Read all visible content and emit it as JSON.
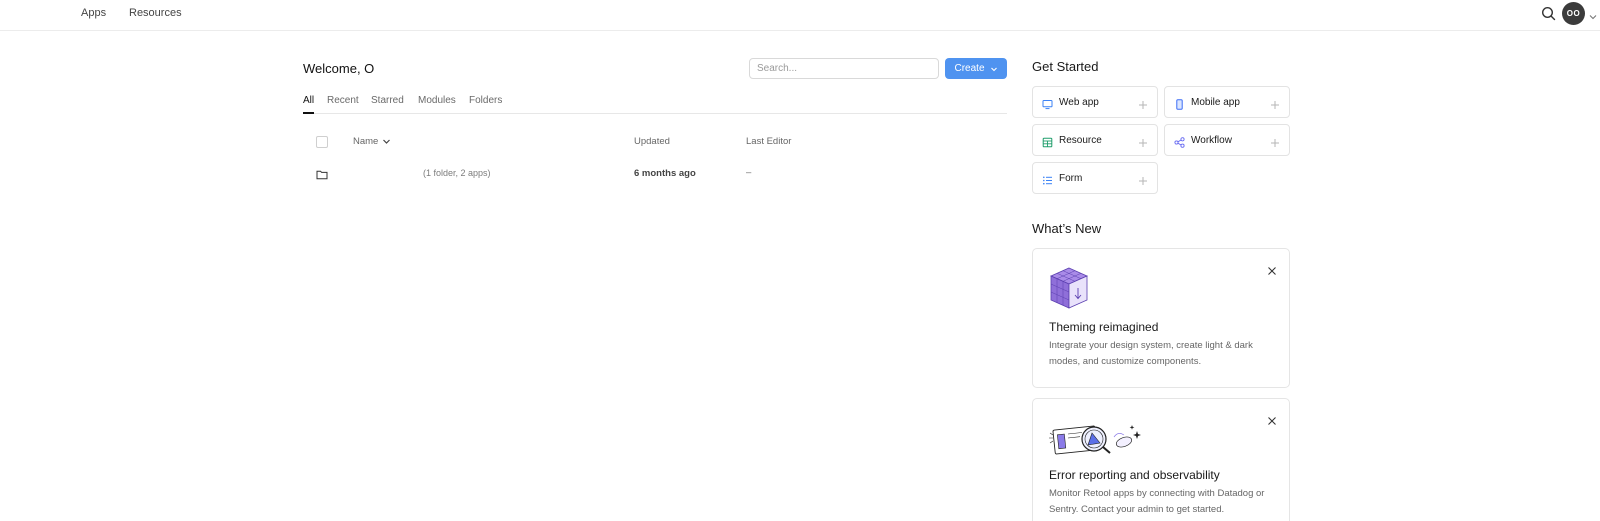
{
  "topnav": {
    "links": [
      "Apps",
      "Resources"
    ],
    "avatar_initials": "OO",
    "icons": {
      "search": "search-icon",
      "caret": "chevron-down-icon"
    }
  },
  "main": {
    "welcome": "Welcome, O",
    "search": {
      "placeholder": "Search...",
      "value": ""
    },
    "create_label": "Create",
    "tabs": [
      {
        "label": "All",
        "active": true
      },
      {
        "label": "Recent",
        "active": false
      },
      {
        "label": "Starred",
        "active": false
      },
      {
        "label": "Modules",
        "active": false
      },
      {
        "label": "Folders",
        "active": false
      }
    ],
    "table": {
      "columns": {
        "name": "Name",
        "updated": "Updated",
        "editor": "Last Editor"
      },
      "rows": [
        {
          "type": "folder",
          "name": "",
          "meta": "(1 folder, 2 apps)",
          "updated": "6 months ago",
          "editor": "–"
        }
      ]
    }
  },
  "get_started": {
    "title": "Get Started",
    "items": [
      {
        "label": "Web app",
        "icon": "monitor-icon",
        "color": "#3b82f6"
      },
      {
        "label": "Mobile app",
        "icon": "phone-icon",
        "color": "#3b6cf6"
      },
      {
        "label": "Resource",
        "icon": "table-icon",
        "color": "#1f9d6b"
      },
      {
        "label": "Workflow",
        "icon": "share-nodes-icon",
        "color": "#6366f1"
      },
      {
        "label": "Form",
        "icon": "list-icon",
        "color": "#3b82f6"
      }
    ]
  },
  "whats_new": {
    "title": "What’s New",
    "cards": [
      {
        "headline": "Theming reimagined",
        "body": "Integrate your design system, create light & dark modes, and customize components.",
        "illustration": "purple-cube-illustration"
      },
      {
        "headline": "Error reporting and observability",
        "body": "Monitor Retool apps by connecting with Datadog or Sentry. Contact your admin to get started.",
        "illustration": "magnifier-bug-illustration"
      }
    ]
  },
  "colors": {
    "accent": "#4f93f0",
    "avatar": "#3b3b3b",
    "border": "#e3e3e3",
    "cube": "#8f6fd9"
  }
}
